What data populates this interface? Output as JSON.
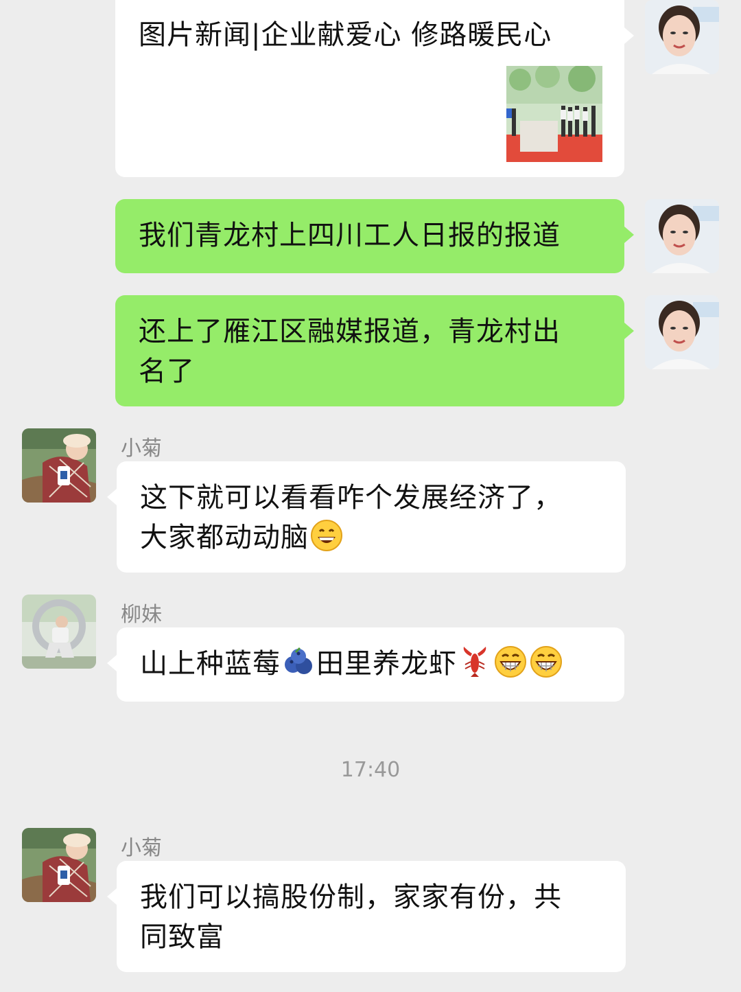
{
  "messages": {
    "news_card": {
      "title": "图片新闻|企业献爱心 修路暖民心"
    },
    "m1": {
      "text": "我们青龙村上四川工人日报的报道"
    },
    "m2": {
      "line1": "还上了雁江区融媒报道，青龙村出",
      "line2": "名了"
    },
    "m3": {
      "sender": "小菊",
      "line1": "这下就可以看看咋个发展经济了，",
      "line2": "大家都动动脑"
    },
    "m4": {
      "sender": "柳妹",
      "part1": "山上种蓝莓",
      "part2": "田里养龙虾"
    },
    "timestamp": "17:40",
    "m5": {
      "sender": "小菊",
      "line1": "我们可以搞股份制，家家有份，共",
      "line2": "同致富"
    }
  },
  "colors": {
    "background": "#ededed",
    "outgoing_bubble": "#95ec69",
    "incoming_bubble": "#ffffff",
    "meta_text": "#888888"
  },
  "icons": [
    "grin-emoji-icon",
    "blueberry-emoji-icon",
    "lobster-emoji-icon",
    "laughing-emoji-icon"
  ]
}
